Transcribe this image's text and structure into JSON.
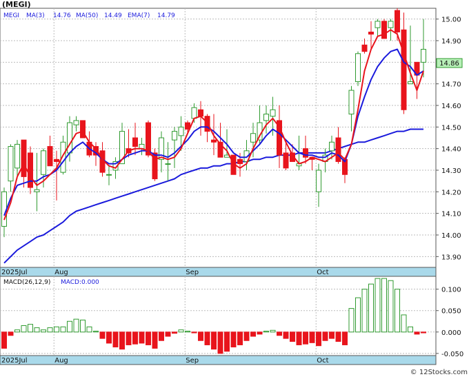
{
  "chart_data": {
    "type": "candlestick",
    "title": "(MEGI)",
    "legend": {
      "symbol": "MEGI",
      "ma3_label": "MA(3)",
      "ma3_value": "14.76",
      "ma50_label": "MA(50)",
      "ma50_value": "14.49",
      "ema7_label": "EMA(7)",
      "ema7_value": "14.79"
    },
    "last_price_label": "14.86",
    "ylim": [
      13.85,
      15.05
    ],
    "yticks": [
      "15.00",
      "14.90",
      "14.80",
      "14.70",
      "14.60",
      "14.50",
      "14.40",
      "14.30",
      "14.20",
      "14.10",
      "14.00",
      "13.90"
    ],
    "xticks": [
      {
        "label": "2025Jul",
        "index": 0
      },
      {
        "label": "Aug",
        "index": 8
      },
      {
        "label": "Sep",
        "index": 28
      },
      {
        "label": "Oct",
        "index": 48
      }
    ],
    "up_color": "#2f9a2f",
    "down_color": "#e8141c",
    "ma3_color": "#e8141c",
    "ma50_color": "#1a1adc",
    "ema7_color": "#1a1adc",
    "ohlc": [
      [
        14.04,
        14.22,
        13.99,
        14.2
      ],
      [
        14.25,
        14.42,
        14.2,
        14.41
      ],
      [
        14.31,
        14.44,
        14.26,
        14.42
      ],
      [
        14.44,
        14.44,
        14.22,
        14.27
      ],
      [
        14.38,
        14.41,
        14.19,
        14.22
      ],
      [
        14.2,
        14.38,
        14.11,
        14.21
      ],
      [
        14.28,
        14.4,
        14.22,
        14.39
      ],
      [
        14.41,
        14.46,
        14.32,
        14.32
      ],
      [
        14.35,
        14.39,
        14.16,
        14.34
      ],
      [
        14.29,
        14.46,
        14.28,
        14.43
      ],
      [
        14.38,
        14.55,
        14.34,
        14.52
      ],
      [
        14.51,
        14.55,
        14.48,
        14.53
      ],
      [
        14.53,
        14.49,
        14.45,
        14.45
      ],
      [
        14.43,
        14.48,
        14.36,
        14.37
      ],
      [
        14.41,
        14.43,
        14.32,
        14.37
      ],
      [
        14.39,
        14.43,
        14.27,
        14.29
      ],
      [
        14.28,
        14.32,
        14.23,
        14.28
      ],
      [
        14.3,
        14.36,
        14.26,
        14.34
      ],
      [
        14.33,
        14.52,
        14.33,
        14.48
      ],
      [
        14.4,
        14.49,
        14.36,
        14.38
      ],
      [
        14.45,
        14.52,
        14.37,
        14.41
      ],
      [
        14.4,
        14.45,
        14.37,
        14.42
      ],
      [
        14.52,
        14.53,
        14.36,
        14.37
      ],
      [
        14.38,
        14.4,
        14.25,
        14.26
      ],
      [
        14.35,
        14.48,
        14.29,
        14.45
      ],
      [
        14.33,
        14.43,
        14.25,
        14.33
      ],
      [
        14.44,
        14.5,
        14.31,
        14.48
      ],
      [
        14.46,
        14.55,
        14.39,
        14.5
      ],
      [
        14.52,
        14.53,
        14.47,
        14.49
      ],
      [
        14.54,
        14.61,
        14.52,
        14.59
      ],
      [
        14.58,
        14.62,
        14.46,
        14.55
      ],
      [
        14.55,
        14.56,
        14.43,
        14.48
      ],
      [
        14.44,
        14.56,
        14.37,
        14.43
      ],
      [
        14.43,
        14.52,
        14.37,
        14.36
      ],
      [
        14.36,
        14.49,
        14.37,
        14.37
      ],
      [
        14.37,
        14.37,
        14.28,
        14.28
      ],
      [
        14.35,
        14.38,
        14.27,
        14.33
      ],
      [
        14.34,
        14.44,
        14.3,
        14.39
      ],
      [
        14.43,
        14.52,
        14.36,
        14.47
      ],
      [
        14.44,
        14.6,
        14.42,
        14.52
      ],
      [
        14.53,
        14.6,
        14.47,
        14.56
      ],
      [
        14.55,
        14.64,
        14.46,
        14.58
      ],
      [
        14.53,
        14.6,
        14.31,
        14.37
      ],
      [
        14.38,
        14.44,
        14.3,
        14.31
      ],
      [
        14.38,
        14.42,
        14.34,
        14.34
      ],
      [
        14.32,
        14.46,
        14.3,
        14.33
      ],
      [
        14.4,
        14.46,
        14.33,
        14.36
      ],
      [
        14.36,
        14.36,
        14.3,
        14.35
      ],
      [
        14.2,
        14.33,
        14.13,
        14.3
      ],
      [
        14.34,
        14.4,
        14.29,
        14.37
      ],
      [
        14.39,
        14.46,
        14.35,
        14.43
      ],
      [
        14.45,
        14.5,
        14.33,
        14.34
      ],
      [
        14.35,
        14.36,
        14.24,
        14.28
      ],
      [
        14.56,
        14.69,
        14.48,
        14.67
      ],
      [
        14.71,
        14.85,
        14.69,
        14.84
      ],
      [
        14.88,
        14.91,
        14.84,
        14.85
      ],
      [
        14.94,
        14.99,
        14.86,
        14.93
      ],
      [
        14.96,
        15.0,
        14.92,
        14.99
      ],
      [
        14.99,
        15.0,
        14.91,
        14.91
      ],
      [
        14.96,
        15.0,
        14.9,
        14.99
      ],
      [
        15.04,
        15.05,
        14.9,
        14.94
      ],
      [
        14.95,
        15.03,
        14.56,
        14.58
      ],
      [
        14.7,
        14.97,
        14.7,
        14.71
      ],
      [
        14.8,
        14.8,
        14.63,
        14.74
      ],
      [
        14.8,
        15.0,
        14.73,
        14.86
      ]
    ],
    "ma3": [
      14.07,
      14.15,
      14.27,
      14.33,
      14.27,
      14.23,
      14.25,
      14.28,
      14.31,
      14.37,
      14.42,
      14.47,
      14.48,
      14.43,
      14.4,
      14.35,
      14.32,
      14.31,
      14.35,
      14.39,
      14.4,
      14.4,
      14.39,
      14.35,
      14.36,
      14.35,
      14.36,
      14.4,
      14.47,
      14.54,
      14.55,
      14.52,
      14.46,
      14.42,
      14.39,
      14.33,
      14.31,
      14.33,
      14.4,
      14.46,
      14.51,
      14.54,
      14.5,
      14.43,
      14.37,
      14.33,
      14.34,
      14.36,
      14.35,
      14.34,
      14.36,
      14.38,
      14.35,
      14.42,
      14.58,
      14.76,
      14.86,
      14.92,
      14.93,
      14.95,
      14.93,
      14.84,
      14.75,
      14.67,
      14.76
    ],
    "ma50": [
      13.87,
      13.9,
      13.93,
      13.95,
      13.97,
      13.99,
      14.0,
      14.02,
      14.04,
      14.06,
      14.09,
      14.11,
      14.12,
      14.13,
      14.14,
      14.15,
      14.16,
      14.17,
      14.18,
      14.19,
      14.2,
      14.21,
      14.22,
      14.23,
      14.24,
      14.25,
      14.26,
      14.28,
      14.29,
      14.3,
      14.31,
      14.31,
      14.32,
      14.32,
      14.33,
      14.33,
      14.34,
      14.34,
      14.35,
      14.35,
      14.36,
      14.36,
      14.37,
      14.37,
      14.37,
      14.38,
      14.38,
      14.38,
      14.38,
      14.38,
      14.39,
      14.4,
      14.41,
      14.42,
      14.43,
      14.43,
      14.44,
      14.45,
      14.46,
      14.47,
      14.48,
      14.48,
      14.49,
      14.49,
      14.49
    ],
    "ema7": [
      14.09,
      14.17,
      14.23,
      14.24,
      14.25,
      14.25,
      14.27,
      14.28,
      14.3,
      14.34,
      14.38,
      14.41,
      14.43,
      14.4,
      14.38,
      14.35,
      14.33,
      14.33,
      14.35,
      14.37,
      14.38,
      14.39,
      14.39,
      14.37,
      14.37,
      14.36,
      14.38,
      14.41,
      14.44,
      14.48,
      14.5,
      14.5,
      14.48,
      14.45,
      14.42,
      14.38,
      14.36,
      14.36,
      14.39,
      14.42,
      14.46,
      14.49,
      14.47,
      14.44,
      14.41,
      14.38,
      14.37,
      14.37,
      14.36,
      14.36,
      14.38,
      14.37,
      14.34,
      14.42,
      14.55,
      14.64,
      14.72,
      14.78,
      14.82,
      14.85,
      14.86,
      14.8,
      14.78,
      14.74,
      14.76
    ]
  },
  "macd": {
    "label": "MACD(26,12,9)",
    "value_label": "MACD:0.000",
    "ylim": [
      -0.055,
      0.13
    ],
    "yticks": [
      "0.100",
      "0.050",
      "0.000",
      "-0.050"
    ],
    "up_color": "#2f9a2f",
    "down_color": "#e8141c",
    "values": [
      -0.038,
      -0.008,
      0.005,
      0.015,
      0.018,
      0.01,
      0.005,
      0.01,
      0.012,
      0.012,
      0.025,
      0.03,
      0.028,
      0.012,
      0.002,
      -0.015,
      -0.026,
      -0.035,
      -0.04,
      -0.03,
      -0.028,
      -0.026,
      -0.03,
      -0.038,
      -0.02,
      -0.01,
      -0.003,
      0.005,
      0.002,
      -0.002,
      -0.02,
      -0.03,
      -0.04,
      -0.05,
      -0.045,
      -0.035,
      -0.03,
      -0.02,
      -0.01,
      -0.005,
      0.002,
      0.004,
      -0.008,
      -0.015,
      -0.022,
      -0.03,
      -0.028,
      -0.025,
      -0.032,
      -0.02,
      -0.015,
      -0.022,
      -0.03,
      0.055,
      0.08,
      0.1,
      0.112,
      0.125,
      0.125,
      0.12,
      0.1,
      0.04,
      0.012,
      -0.005,
      -0.002
    ]
  },
  "footer": {
    "watermark": "© 12Stocks.com"
  }
}
